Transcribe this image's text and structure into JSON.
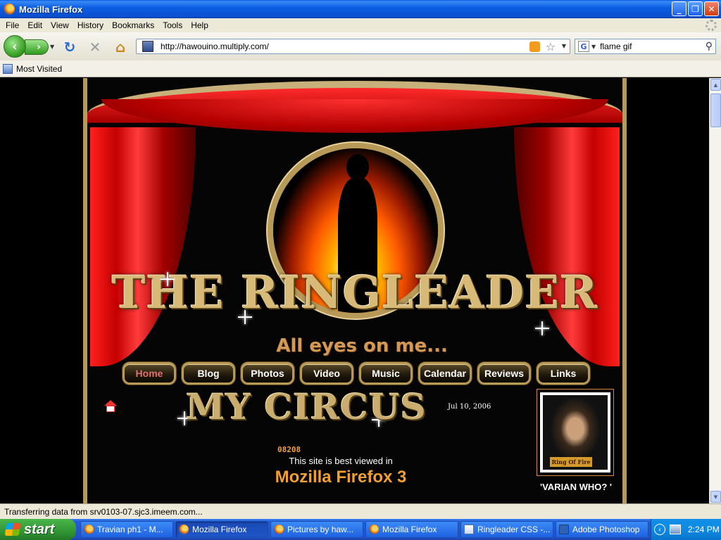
{
  "window": {
    "title": "Mozilla Firefox",
    "controls": [
      "_",
      "❐",
      "✕"
    ]
  },
  "menu": [
    "File",
    "Edit",
    "View",
    "History",
    "Bookmarks",
    "Tools",
    "Help"
  ],
  "toolbar": {
    "url": "http://hawouino.multiply.com/",
    "search_value": "flame gif",
    "search_engine_icon": "G"
  },
  "bookmarks": {
    "most_visited": "Most Visited"
  },
  "page": {
    "brand": "THE RINGLEADER",
    "tagline": "All eyes on me...",
    "nav": [
      {
        "label": "Home",
        "active": true
      },
      {
        "label": "Blog",
        "active": false
      },
      {
        "label": "Photos",
        "active": false
      },
      {
        "label": "Video",
        "active": false
      },
      {
        "label": "Music",
        "active": false
      },
      {
        "label": "Calendar",
        "active": false
      },
      {
        "label": "Reviews",
        "active": false
      },
      {
        "label": "Links",
        "active": false
      }
    ],
    "section_title": "MY CIRCUS",
    "date": "Jul 10, 2006",
    "counter": "08208",
    "best_viewed": "This site is best viewed in",
    "best_browser": "Mozilla Firefox 3",
    "profile_badge": "Ring Of Fire",
    "profile_caption": "'VARIAN WHO? '"
  },
  "status": "Transferring data from srv0103-07.sjc3.imeem.com...",
  "taskbar": {
    "start": "start",
    "tasks": [
      {
        "label": "Travian ph1 - M...",
        "icon": "firefox-icon",
        "active": false
      },
      {
        "label": "Mozilla Firefox",
        "icon": "firefox-icon",
        "active": true
      },
      {
        "label": "Pictures by haw...",
        "icon": "firefox-icon",
        "active": false
      },
      {
        "label": "Mozilla Firefox",
        "icon": "firefox-icon",
        "active": false
      },
      {
        "label": "Ringleader CSS -...",
        "icon": "document-icon",
        "active": false
      },
      {
        "label": "Adobe Photoshop",
        "icon": "photoshop-icon",
        "active": false
      }
    ],
    "clock": "2:24 PM"
  }
}
